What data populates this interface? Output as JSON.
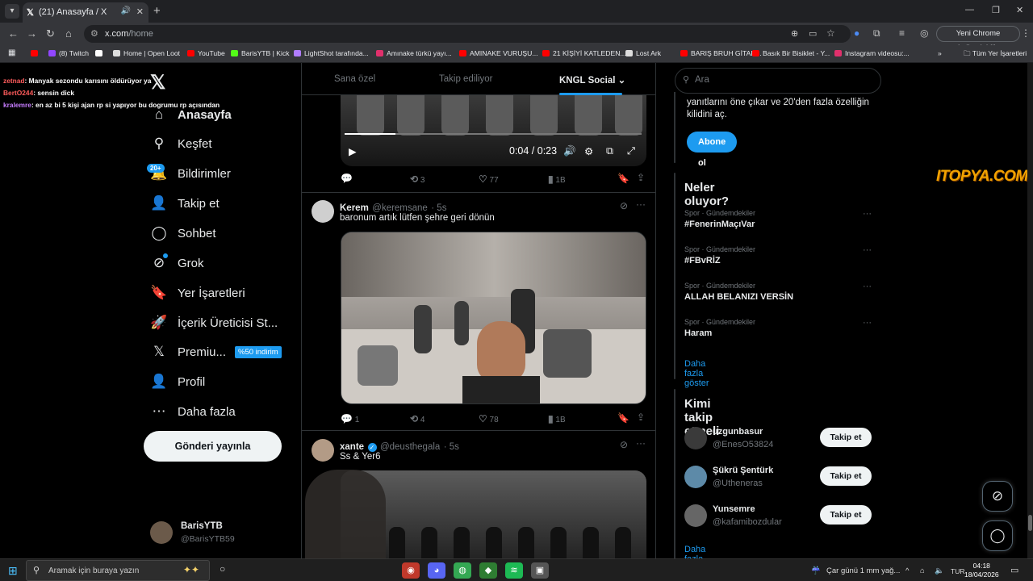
{
  "browser": {
    "tab_title": "(21) Anasayfa / X",
    "url_host": "x.com",
    "url_path": "/home",
    "update_button": "Yeni Chrome kullanılabilir",
    "bookmarks": [
      {
        "label": "",
        "color": "#ff0000"
      },
      {
        "label": "(8) Twitch",
        "color": "#9146ff"
      },
      {
        "label": "",
        "color": "#ffffff"
      },
      {
        "label": "Home | Open Loot",
        "color": "#dddddd"
      },
      {
        "label": "YouTube",
        "color": "#ff0000"
      },
      {
        "label": "BarisYTB | Kick",
        "color": "#53fc18"
      },
      {
        "label": "LightShot tarafında...",
        "color": "#b07cff"
      },
      {
        "label": "Amınake türkü yayı...",
        "color": "#e1306c"
      },
      {
        "label": "AMINAKE VURUŞU...",
        "color": "#ff0000"
      },
      {
        "label": "21 KİŞİYİ KATLEDEN...",
        "color": "#ff0000"
      },
      {
        "label": "Lost Ark",
        "color": "#dddddd"
      },
      {
        "label": "BARIŞ BRUH GİTAR...",
        "color": "#ff0000"
      },
      {
        "label": "Basık Bir Bisiklet - Y...",
        "color": "#ff0000"
      },
      {
        "label": "Instagram videosu:...",
        "color": "#e1306c"
      }
    ],
    "all_bookmarks": "Tüm Yer İşaretleri"
  },
  "chat_overlay": [
    {
      "user": "zetnad",
      "user_color": "#ff5c5c",
      "text": ": Manyak sezondu karısını öldürüyor ya"
    },
    {
      "user": "BertO244",
      "user_color": "#ff5c5c",
      "text": ": sensin dick"
    },
    {
      "user": "kralemre",
      "user_color": "#c77dff",
      "text": ": en az bi 5 kişi ajan rp si yapıyor bu dogrumu rp açısından"
    }
  ],
  "nav": {
    "items": [
      {
        "label": "Anasayfa",
        "icon": "home-icon"
      },
      {
        "label": "Keşfet",
        "icon": "search-icon"
      },
      {
        "label": "Bildirimler",
        "icon": "bell-icon"
      },
      {
        "label": "Takip et",
        "icon": "follow-icon"
      },
      {
        "label": "Sohbet",
        "icon": "chat-icon"
      },
      {
        "label": "Grok",
        "icon": "grok-icon"
      },
      {
        "label": "Yer İşaretleri",
        "icon": "bookmark-icon"
      },
      {
        "label": "İçerik Üreticisi St...",
        "icon": "rocket-icon"
      },
      {
        "label": "Premiu...",
        "icon": "x-logo-icon"
      },
      {
        "label": "Profil",
        "icon": "profile-icon"
      },
      {
        "label": "Daha fazla",
        "icon": "more-icon"
      }
    ],
    "notif_badge": "20+",
    "premium_promo": "%50 indirim",
    "post_button": "Gönderi yayınla",
    "account_name": "BarisYTB",
    "account_handle": "@BarisYTB59"
  },
  "feed_tabs": [
    "Sana özel",
    "Takip ediliyor",
    "KNGL Social"
  ],
  "video": {
    "time": "0:04 / 0:23",
    "progress": 0.17
  },
  "posts": [
    {
      "replies": "",
      "reposts": "3",
      "likes": "77",
      "views": "1B"
    },
    {
      "name": "Kerem",
      "handle": "@keremsane",
      "time": "· 5s",
      "text": "baronum artık lütfen şehre geri dönün",
      "replies": "1",
      "reposts": "4",
      "likes": "78",
      "views": "1B"
    },
    {
      "name": "xante",
      "handle": "@deusthegala",
      "time": "· 5s",
      "text": "Ss & Yer6"
    }
  ],
  "right": {
    "search_placeholder": "Ara",
    "premium_text": "yanıtlarını öne çıkar ve 20'den fazla özelliğin kilidini aç.",
    "premium_button": "Abone ol",
    "trends_title": "Neler oluyor?",
    "trends": [
      {
        "category": "Spor · Gündemdekiler",
        "tag": "#FenerinMaçıVar"
      },
      {
        "category": "Spor · Gündemdekiler",
        "tag": "#FBvRİZ"
      },
      {
        "category": "Spor · Gündemdekiler",
        "tag": "ALLAH BELANIZI VERSİN"
      },
      {
        "category": "Spor · Gündemdekiler",
        "tag": "Haram"
      }
    ],
    "show_more": "Daha fazla göster",
    "who_title": "Kimi takip etmeli",
    "who": [
      {
        "name": "uzgunbasur",
        "handle": "@EnesO53824",
        "button": "Takip et",
        "avatar_color": "#3a3a3a"
      },
      {
        "name": "Şükrü Şentürk",
        "handle": "@Utheneras",
        "button": "Takip et",
        "avatar_color": "#5d8aa8"
      },
      {
        "name": "Yunsemre",
        "handle": "@kafamibozdular",
        "button": "Takip et",
        "avatar_color": "#666666"
      }
    ],
    "who_more": "Daha fazla göster"
  },
  "watermark": "ITOPYA.COM",
  "taskbar": {
    "search_placeholder": "Aramak için buraya yazın",
    "weather": "Çar günü 1 mm yağ...",
    "lang": "TUR",
    "time": "04:18",
    "date": "18/04/2026"
  }
}
